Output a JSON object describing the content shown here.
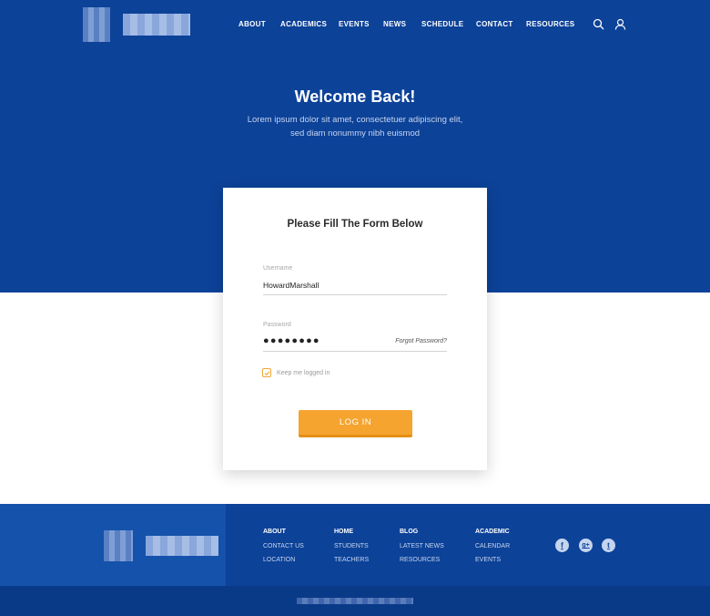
{
  "header": {
    "nav": [
      {
        "label": "ABOUT",
        "name": "nav-about"
      },
      {
        "label": "ACADEMICS",
        "name": "nav-academics"
      },
      {
        "label": "EVENTS",
        "name": "nav-events"
      },
      {
        "label": "NEWS",
        "name": "nav-news"
      },
      {
        "label": "SCHEDULE",
        "name": "nav-schedule"
      },
      {
        "label": "CONTACT",
        "name": "nav-contact"
      },
      {
        "label": "RESOURCES",
        "name": "nav-resources"
      }
    ],
    "icons": {
      "search": "search-icon",
      "user": "user-icon"
    }
  },
  "hero": {
    "title": "Welcome Back!",
    "subtitle_line1": "Lorem ipsum dolor sit amet, consectetuer adipiscing elit,",
    "subtitle_line2": "sed diam nonummy nibh euismod"
  },
  "form": {
    "title": "Please Fill The Form Below",
    "username_label": "Username",
    "username_value": "HowardMarshall",
    "password_label": "Password",
    "password_dots": "●●●●●●●●",
    "forgot": "Forgot Password?",
    "keep_logged_in": "Keep me logged in",
    "keep_checked": true,
    "login_button": "LOG IN"
  },
  "footer": {
    "columns": [
      {
        "head": "ABOUT",
        "links": [
          "CONTACT US",
          "LOCATION"
        ]
      },
      {
        "head": "HOME",
        "links": [
          "STUDENTS",
          "TEACHERS"
        ]
      },
      {
        "head": "BLOG",
        "links": [
          "LATEST NEWS",
          "RESOURCES"
        ]
      },
      {
        "head": "ACADEMIC",
        "links": [
          "CALENDAR",
          "EVENTS"
        ]
      }
    ],
    "social": [
      {
        "icon": "facebook-icon",
        "glyph": "f"
      },
      {
        "icon": "google-plus-icon",
        "glyph": "g+"
      },
      {
        "icon": "twitter-icon",
        "glyph": "t"
      }
    ]
  },
  "colors": {
    "brand_blue": "#0c4298",
    "accent_orange": "#f5a42f",
    "footer_highlight": "#1452ab"
  }
}
